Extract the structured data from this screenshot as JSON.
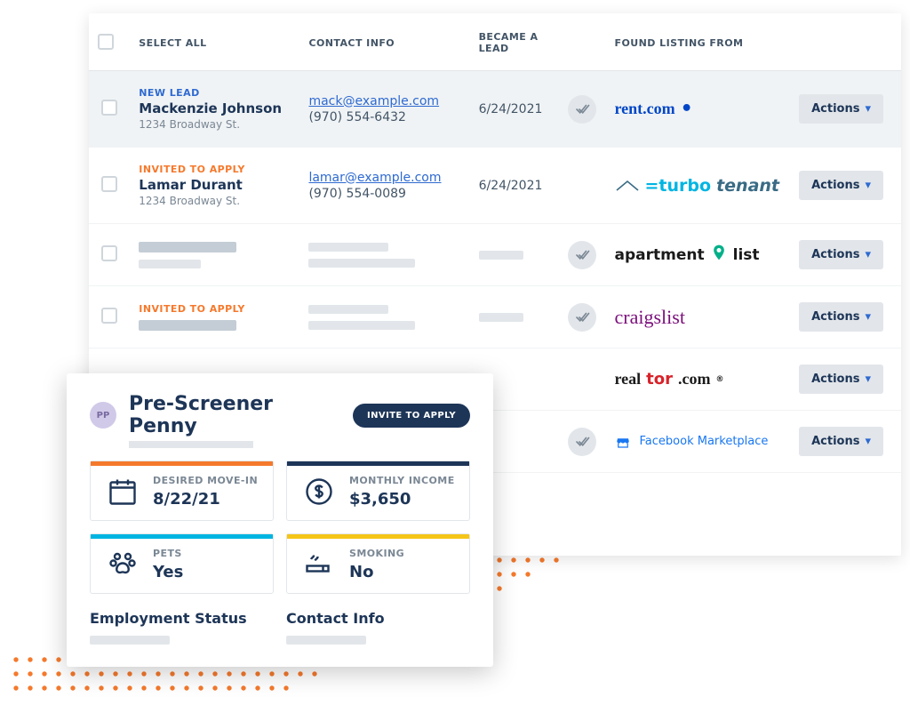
{
  "table": {
    "headers": {
      "select": "SELECT ALL",
      "contact": "CONTACT INFO",
      "became": "BECAME A LEAD",
      "from": "FOUND LISTING FROM"
    },
    "actions_label": "Actions",
    "rows": [
      {
        "tag_kind": "new",
        "tag": "NEW LEAD",
        "name": "Mackenzie Johnson",
        "addr": "1234 Broadway St.",
        "email": "mack@example.com",
        "phone": "(970) 554-6432",
        "date": "6/24/2021",
        "show_check_icon": true,
        "source": "rent",
        "highlight": true
      },
      {
        "tag_kind": "invited",
        "tag": "INVITED TO APPLY",
        "name": "Lamar Durant",
        "addr": "1234 Broadway St.",
        "email": "lamar@example.com",
        "phone": "(970) 554-0089",
        "date": "6/24/2021",
        "show_check_icon": false,
        "source": "turbo"
      },
      {
        "placeholder": true,
        "show_check_icon": true,
        "source": "aptlist"
      },
      {
        "tag_kind": "invited",
        "tag": "INVITED TO APPLY",
        "placeholder_after_tag": true,
        "show_check_icon": true,
        "source": "craig"
      },
      {
        "placeholder": true,
        "hide_left_columns": true,
        "show_check_icon": false,
        "source": "realtor"
      },
      {
        "placeholder": true,
        "hide_left_columns": true,
        "show_check_icon": true,
        "source": "fb"
      }
    ]
  },
  "sources": {
    "rent": "rent.com",
    "turbo_blue": "=turbo",
    "turbo_rest": "tenant",
    "aptlist_a": "apartment",
    "aptlist_b": "list",
    "craig": "craigslist",
    "realtor_a": "real",
    "realtor_b": "tor",
    "realtor_c": ".com",
    "fb": "Facebook Marketplace"
  },
  "card": {
    "avatar_initials": "PP",
    "title": "Pre-Screener Penny",
    "invite_label": "INVITE TO APPLY",
    "tiles": {
      "movein": {
        "label": "DESIRED MOVE-IN",
        "value": "8/22/21"
      },
      "income": {
        "label": "MONTHLY INCOME",
        "value": "$3,650"
      },
      "pets": {
        "label": "PETS",
        "value": "Yes"
      },
      "smoke": {
        "label": "SMOKING",
        "value": "No"
      }
    },
    "sections": {
      "employment": "Employment Status",
      "contact": "Contact Info"
    }
  }
}
